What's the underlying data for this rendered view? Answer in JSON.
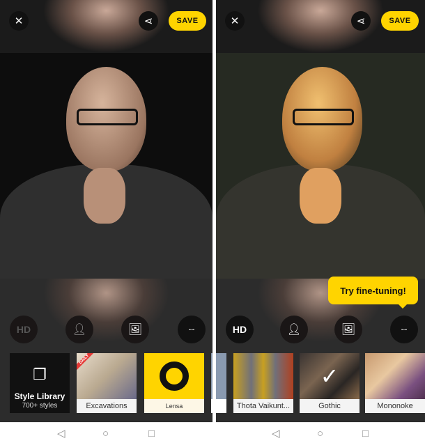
{
  "left_screen": {
    "toolbar": {
      "close_icon": "close-icon",
      "share_icon": "share-icon",
      "save_label": "SAVE"
    },
    "tools": [
      {
        "label": "HD",
        "state": "disabled"
      },
      {
        "icon": "person-icon"
      },
      {
        "icon": "image-icon"
      },
      {
        "icon": "sliders-icon"
      }
    ],
    "styles": [
      {
        "title": "Style Library",
        "subtitle": "700+ styles",
        "icon": "photos-icon"
      },
      {
        "label": "Excavations",
        "badge": "DAILY"
      },
      {
        "label": "Lensa"
      }
    ]
  },
  "right_screen": {
    "toolbar": {
      "close_icon": "close-icon",
      "share_icon": "share-icon",
      "save_label": "SAVE"
    },
    "tooltip": "Try fine-tuning!",
    "tools": [
      {
        "label": "HD"
      },
      {
        "icon": "person-icon"
      },
      {
        "icon": "image-icon"
      },
      {
        "icon": "sliders-icon"
      }
    ],
    "styles": [
      {
        "label": "Thota Vaikunt..."
      },
      {
        "label": "Gothic",
        "selected": true
      },
      {
        "label": "Mononoke"
      }
    ]
  },
  "nav": {
    "back": "◁",
    "home": "○",
    "recents": "□"
  },
  "colors": {
    "accent": "#ffd400",
    "background": "#2a2a2a"
  }
}
